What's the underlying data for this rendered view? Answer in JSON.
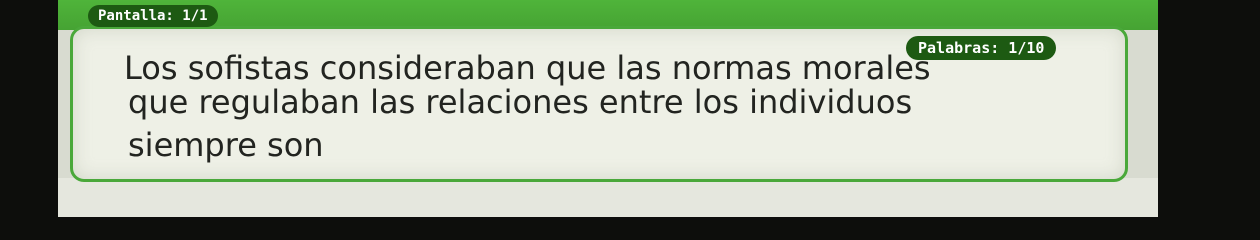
{
  "header": {
    "screen_counter": "Pantalla: 1/1",
    "word_counter": "Palabras: 1/10"
  },
  "reading": {
    "lines": [
      "Los sofistas consideraban que las normas morales",
      "que regulaban las relaciones entre los individuos",
      "siempre son"
    ]
  },
  "colors": {
    "accent_green": "#4fb43a",
    "pill_dark_green": "#1d5a12",
    "panel_bg": "#eef0e6"
  }
}
